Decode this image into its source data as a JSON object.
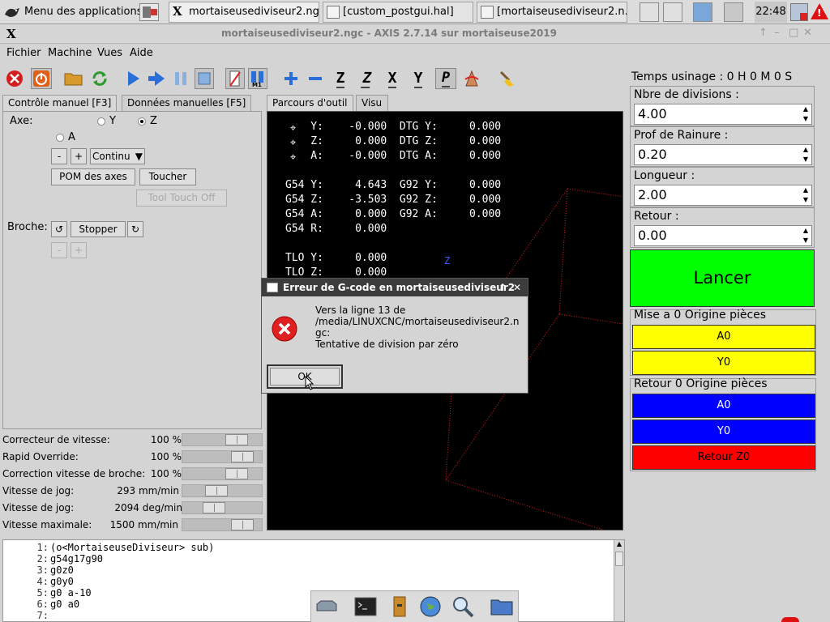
{
  "taskbar": {
    "app_menu": "Menu des applications",
    "tasks": [
      "mortaiseusediviseur2.ng...",
      "[custom_postgui.hal]",
      "[mortaiseusediviseur2.n..."
    ],
    "clock": "22:48"
  },
  "window": {
    "title": "mortaiseusediviseur2.ngc - AXIS 2.7.14 sur mortaiseuse2019",
    "logo": "X",
    "controls": [
      "↑",
      "–",
      "□",
      "✕"
    ]
  },
  "menubar": [
    "Fichier",
    "Machine",
    "Vues",
    "Aide"
  ],
  "toolbar": {
    "icons": [
      "estop-icon",
      "power-icon",
      "open-file-icon",
      "reload-icon",
      "run-icon",
      "step-icon",
      "pause-icon",
      "stop-icon",
      "block-delete-icon",
      "optional-stop-icon",
      "zoom-in-icon",
      "zoom-out-icon",
      "view-z-icon",
      "view-z2-icon",
      "view-x-icon",
      "view-y-icon",
      "view-p-icon",
      "rotate-icon",
      "clear-plot-icon"
    ],
    "letters": [
      "Z",
      "Z",
      "X",
      "Y",
      "P"
    ]
  },
  "left_tabs": [
    "Contrôle manuel [F3]",
    "Données manuelles [F5]"
  ],
  "manual": {
    "axis_label": "Axe:",
    "axes": [
      "Y",
      "Z",
      "A"
    ],
    "selected_axis": "Z",
    "minus": "-",
    "plus": "+",
    "jog_mode": "Continu",
    "home_button": "POM des axes",
    "touch_button": "Toucher",
    "tool_touch_off": "Tool Touch Off",
    "spindle_label": "Broche:",
    "spindle_stop": "Stopper"
  },
  "sliders": [
    {
      "label": "Correcteur de vitesse:",
      "value": "100 %",
      "level": 0.75
    },
    {
      "label": "Rapid Override:",
      "value": "100 %",
      "level": 0.85
    },
    {
      "label": "Correction vitesse de broche:",
      "value": "100 %",
      "level": 0.75
    },
    {
      "label": "Vitesse de jog:",
      "value": "293 mm/min",
      "level": 0.4
    },
    {
      "label": "Vitesse de jog:",
      "value": "2094 deg/min",
      "level": 0.35
    },
    {
      "label": "Vitesse maximale:",
      "value": "1500 mm/min",
      "level": 0.85
    }
  ],
  "preview_tabs": [
    "Parcours d'outil",
    "Visu"
  ],
  "dro": [
    "    Y:    -0.000  DTG Y:     0.000",
    "    Z:     0.000  DTG Z:     0.000",
    "    A:    -0.000  DTG A:     0.000",
    "",
    "G54 Y:     4.643  G92 Y:     0.000",
    "G54 Z:    -3.503  G92 Z:     0.000",
    "G54 A:     0.000  G92 A:     0.000",
    "G54 R:     0.000",
    "",
    "TLO Y:     0.000",
    "TLO Z:     0.000"
  ],
  "axis_marker": "Z",
  "right": {
    "time": "Temps usinage :  0 H  0 M  0 S",
    "fields": [
      {
        "label": "Nbre de divisions :",
        "value": "4.00"
      },
      {
        "label": "Prof de Rainure :",
        "value": "0.20"
      },
      {
        "label": "Longueur :",
        "value": "2.00"
      },
      {
        "label": "Retour :",
        "value": "0.00"
      }
    ],
    "launch": "Lancer",
    "group1_title": "Mise a 0 Origine pièces",
    "group1_buttons": [
      "A0",
      "Y0"
    ],
    "group2_title": "Retour 0 Origine pièces",
    "group2_buttons": [
      "A0",
      "Y0",
      "Retour Z0"
    ],
    "colors": {
      "launch": "#00ff00",
      "yellow": "#ffff00",
      "blue": "#0000ff",
      "red": "#ff0000"
    }
  },
  "gcode": {
    "line_numbers": [
      "1:",
      "2:",
      "3:",
      "4:",
      "5:",
      "6:",
      "7:"
    ],
    "lines": [
      "(o<MortaiseuseDiviseur> sub)",
      "g54g17g90",
      "g0z0",
      "g0y0",
      "g0 a-10",
      "g0 a0",
      ""
    ]
  },
  "dialog": {
    "title": "Erreur de G-code en mortaiseusediviseur2",
    "message": "Vers la ligne 13 de\n/media/LINUXCNC/mortaiseusediviseur2.n\ngc:\nTentative de division par zéro",
    "ok": "OK",
    "controls": [
      "↑",
      "✕"
    ]
  }
}
